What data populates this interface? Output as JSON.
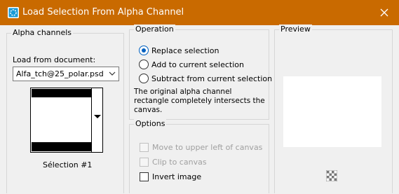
{
  "window": {
    "title": "Load Selection From Alpha Channel",
    "close_glyph": "✕"
  },
  "alpha_channels": {
    "group_label": "Alpha channels",
    "load_from_label": "Load from document:",
    "document_value": "Alfa_tch@25_polar.psd",
    "thumbnail_caption": "Sélection #1"
  },
  "operation": {
    "group_label": "Operation",
    "options": [
      {
        "label": "Replace selection",
        "checked": true
      },
      {
        "label": "Add to current selection",
        "checked": false
      },
      {
        "label": "Subtract from current selection",
        "checked": false
      }
    ],
    "description_lines": [
      "The original alpha channel",
      "rectangle completely intersects the",
      "canvas."
    ]
  },
  "options": {
    "group_label": "Options",
    "checkboxes": [
      {
        "label": "Move to upper left of canvas",
        "checked": false,
        "enabled": false
      },
      {
        "label": "Clip to canvas",
        "checked": false,
        "enabled": false
      },
      {
        "label": "Invert image",
        "checked": false,
        "enabled": true
      }
    ]
  },
  "preview": {
    "group_label": "Preview"
  },
  "colors": {
    "titlebar": "#c96a00",
    "accent": "#0060c0"
  }
}
